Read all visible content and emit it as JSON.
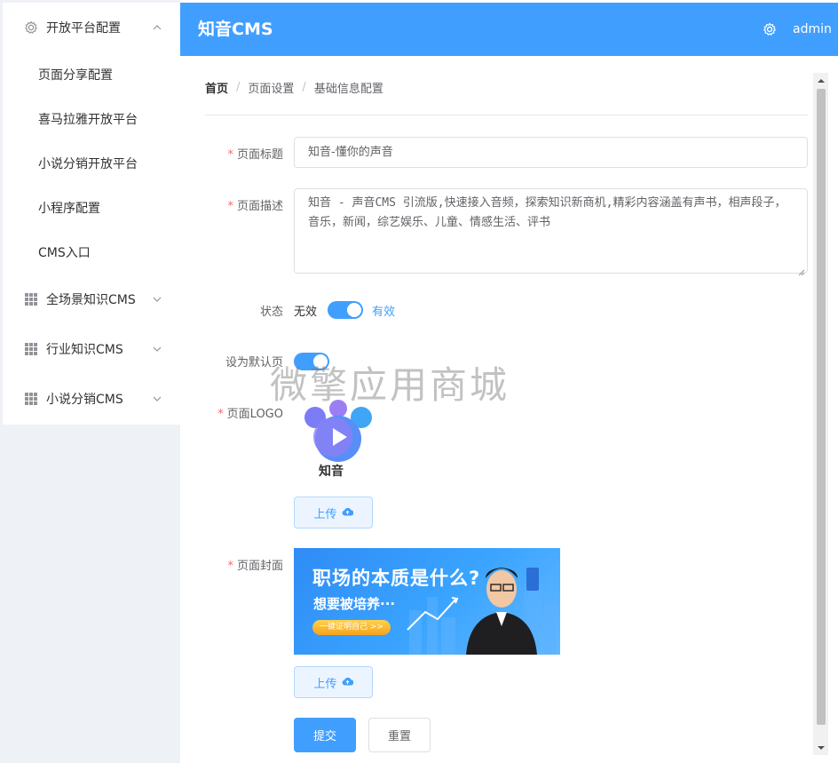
{
  "app": {
    "title": "知音CMS",
    "user": "admin"
  },
  "sidebar": {
    "menus": [
      {
        "label": "开放平台配置",
        "icon": "gear-icon",
        "expanded": true,
        "items": [
          {
            "label": "页面分享配置"
          },
          {
            "label": "喜马拉雅开放平台"
          },
          {
            "label": "小说分销开放平台"
          },
          {
            "label": "小程序配置"
          },
          {
            "label": "CMS入口"
          }
        ]
      },
      {
        "label": "全场景知识CMS",
        "icon": "grid-icon",
        "expanded": false
      },
      {
        "label": "行业知识CMS",
        "icon": "grid-icon",
        "expanded": false
      },
      {
        "label": "小说分销CMS",
        "icon": "grid-icon",
        "expanded": false
      }
    ]
  },
  "breadcrumb": [
    "首页",
    "页面设置",
    "基础信息配置"
  ],
  "form": {
    "required_mark": "*",
    "title": {
      "label": "页面标题",
      "value": "知音-懂你的声音"
    },
    "description": {
      "label": "页面描述",
      "value": "知音 - 声音CMS 引流版,快速接入音频，探索知识新商机,精彩内容涵盖有声书，相声段子，音乐，新闻，综艺娱乐、儿童、情感生活、评书"
    },
    "status": {
      "label": "状态",
      "off_text": "无效",
      "on_text": "有效",
      "enabled": true
    },
    "default_page": {
      "label": "设为默认页",
      "enabled": true
    },
    "logo": {
      "label": "页面LOGO",
      "logo_text": "知音",
      "upload_label": "上传"
    },
    "cover": {
      "label": "页面封面",
      "title": "职场的本质是什么?",
      "subtitle": "想要被培养···",
      "button": "一键证明自己 >>",
      "upload_label": "上传"
    },
    "submit_label": "提交",
    "reset_label": "重置"
  },
  "watermark": "微擎应用商城",
  "colors": {
    "primary": "#409eff",
    "required": "#f56c6c",
    "sidebar_bg": "#eef1f6"
  }
}
